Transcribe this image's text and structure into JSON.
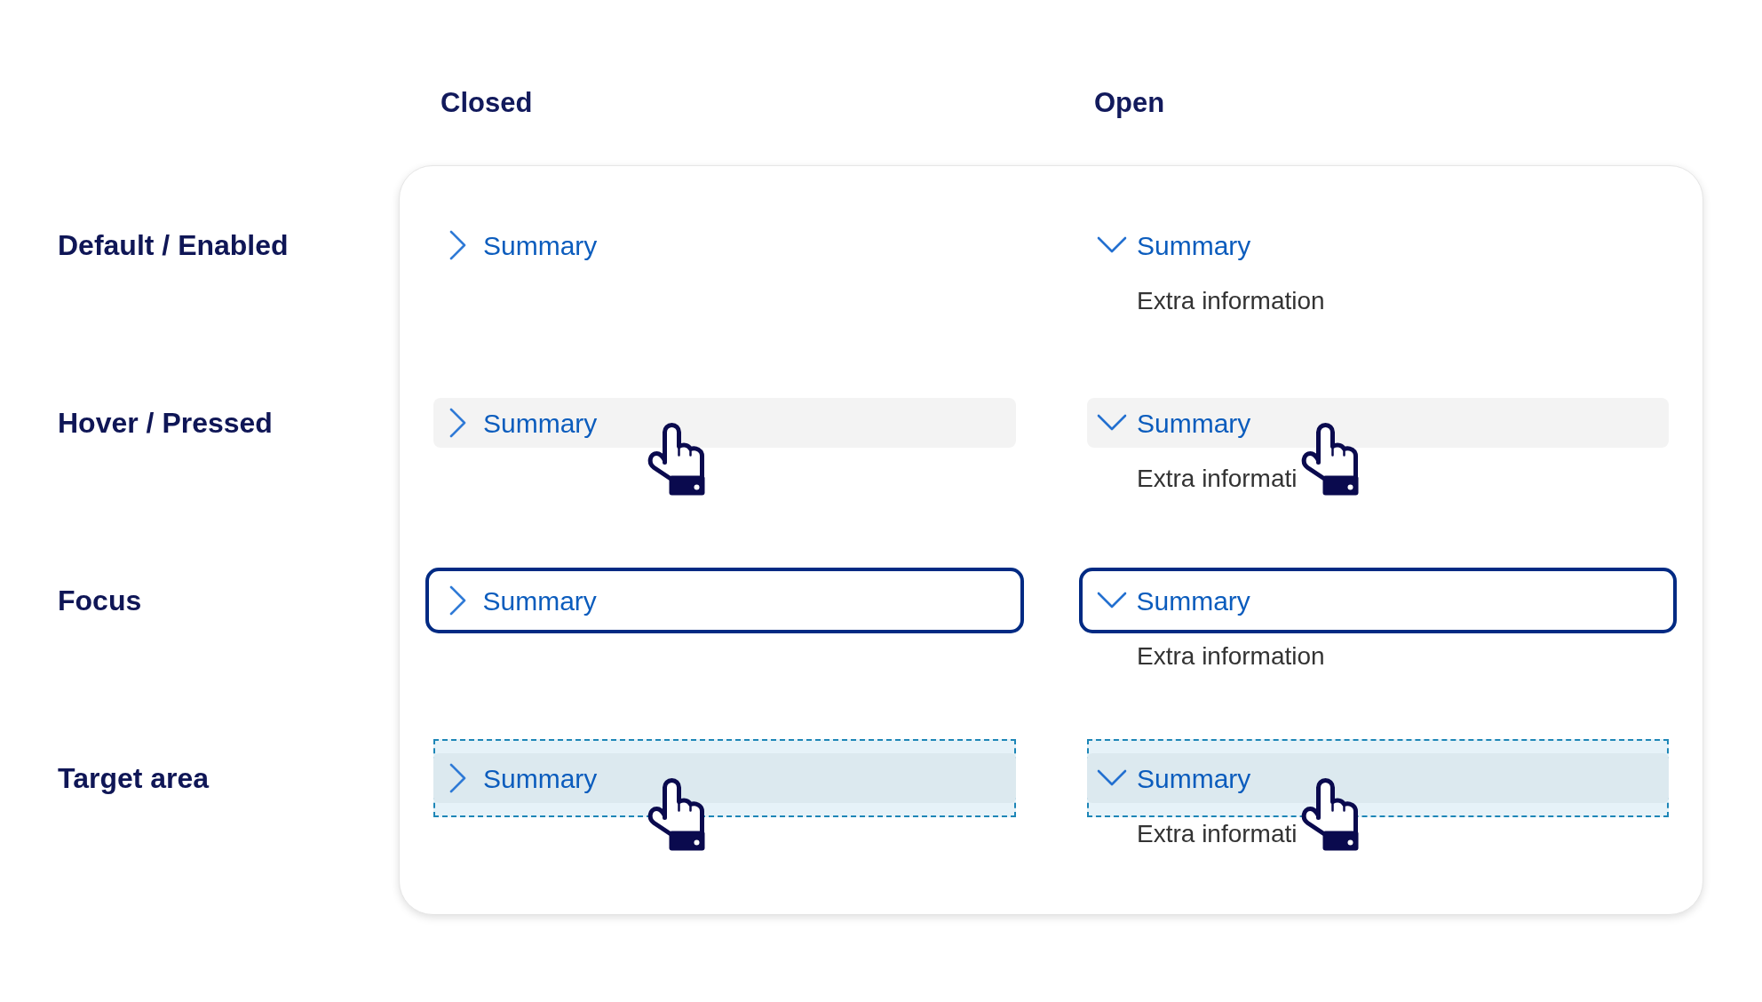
{
  "columns": [
    "Closed",
    "Open"
  ],
  "rows": [
    {
      "label": "Default / Enabled",
      "kind": "default",
      "cells": [
        {
          "summary": "Summary",
          "expanded": false,
          "cursor": false
        },
        {
          "summary": "Summary",
          "expanded": true,
          "details": "Extra information",
          "cursor": false
        }
      ]
    },
    {
      "label": "Hover / Pressed",
      "kind": "hover",
      "cells": [
        {
          "summary": "Summary",
          "expanded": false,
          "cursor": true
        },
        {
          "summary": "Summary",
          "expanded": true,
          "details": "Extra informati",
          "cursor": true
        }
      ]
    },
    {
      "label": "Focus",
      "kind": "focus",
      "cells": [
        {
          "summary": "Summary",
          "expanded": false,
          "cursor": false
        },
        {
          "summary": "Summary",
          "expanded": true,
          "details": "Extra information",
          "cursor": false
        }
      ]
    },
    {
      "label": "Target area",
      "kind": "target",
      "cells": [
        {
          "summary": "Summary",
          "expanded": false,
          "cursor": true
        },
        {
          "summary": "Summary",
          "expanded": true,
          "details": "Extra informati",
          "cursor": true
        }
      ]
    }
  ]
}
